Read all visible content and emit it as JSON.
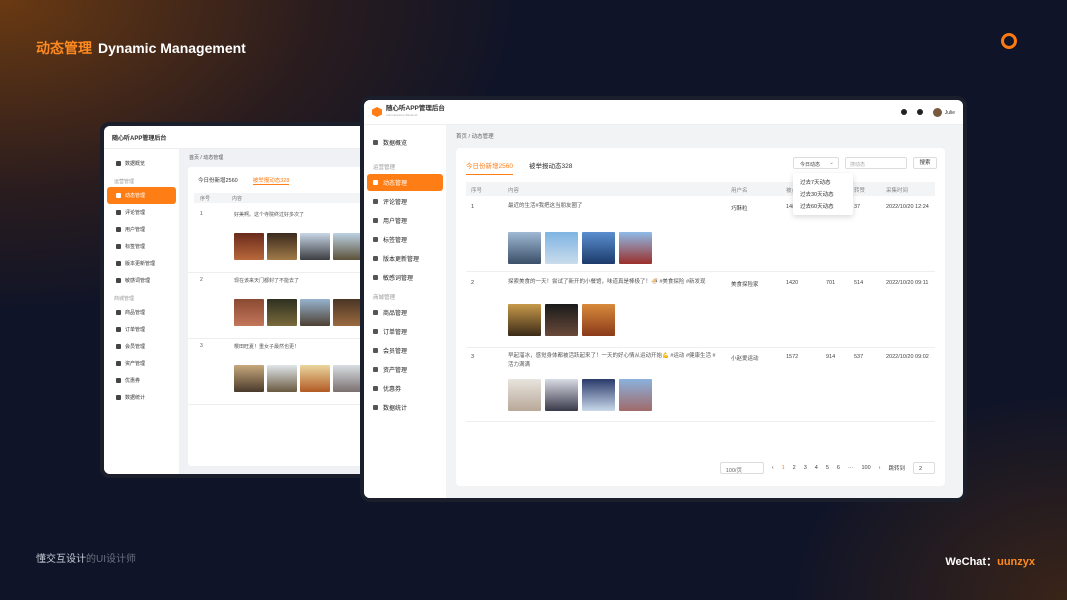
{
  "header": {
    "title_cn": "动态管理",
    "title_en": "Dynamic Management"
  },
  "footer": {
    "left_strong": "懂交互设计",
    "left_dim": "的UI设计师",
    "wechat_label": "WeChat：",
    "wechat_id": "uunzyx"
  },
  "app": {
    "title": "随心听APP管理后台",
    "subtitle": "Administrative Backend",
    "user": "Julie"
  },
  "sidebar": {
    "top_item": "数据概览",
    "group1": "运营管理",
    "group1_items": [
      "动态管理",
      "评论管理",
      "用户管理",
      "标签管理",
      "版本更新管理",
      "敏感词管理"
    ],
    "group2": "商城管理",
    "group2_items": [
      "商品管理",
      "订单管理",
      "会员管理",
      "资产管理",
      "优惠券",
      "数据统计"
    ]
  },
  "breadcrumb": {
    "home": "首页",
    "sep": "/",
    "current": "动态管理"
  },
  "tabs": [
    "今日份新增2560",
    "被举报动态328"
  ],
  "filter": {
    "select": "今日动态",
    "search_placeholder": "搜动态",
    "search_button": "搜索",
    "options": [
      "过去7天动态",
      "过去30天动态",
      "过去60天动态"
    ]
  },
  "table": {
    "headers": [
      "序号",
      "内容",
      "用户名",
      "被点赞",
      "评论",
      "转赞",
      "采集时间"
    ],
    "rows": [
      {
        "no": "1",
        "content": "最近的生活#我把这当朋友圈了",
        "user": "巧酥粒",
        "likes": "1483",
        "comments": "",
        "shares": "37",
        "time": "2022/10/20  12:24"
      },
      {
        "no": "2",
        "content": "探索美食的一天！尝试了新开的小餐馆，味道真是棒极了！🍜 #美食探险 #新发现",
        "user": "美食探险家",
        "likes": "1420",
        "comments": "701",
        "shares": "514",
        "time": "2022/10/20  09:11"
      },
      {
        "no": "3",
        "content": "早起溜冰，感觉身体都被活跃起来了！一天的好心情从运动开始💪 #运动 #健康生活 #活力满满",
        "user": "小赵爱运动",
        "likes": "1572",
        "comments": "914",
        "shares": "537",
        "time": "2022/10/20  09:02"
      }
    ]
  },
  "pagination": {
    "page_size": "100/页",
    "pages": [
      "1",
      "2",
      "3",
      "4",
      "5",
      "6",
      "···",
      "100"
    ],
    "jump_label": "跳转到",
    "jump_value": "2",
    "prev": "‹",
    "next": "›"
  },
  "back": {
    "rows": [
      {
        "no": "1",
        "content": "好美啊。这个寺院终过好多次了"
      },
      {
        "no": "2",
        "content": "现在该来天门都封了不能去了"
      },
      {
        "no": "3",
        "content": "樱田旺夏！重女子最然也更！"
      }
    ]
  },
  "colors": {
    "accent": "#ff7d15"
  }
}
